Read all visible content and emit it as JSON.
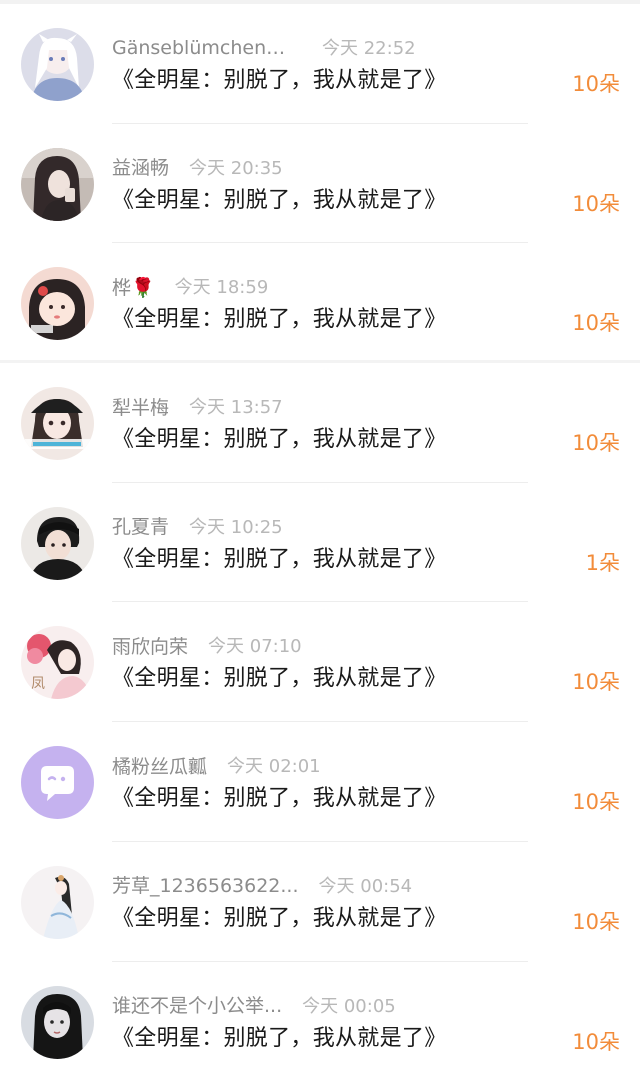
{
  "records": [
    {
      "name": "Gänseblümchen🌿...",
      "time": "今天 22:52",
      "message": "《全明星：别脱了，我从就是了》",
      "gift": "10朵",
      "avatar_icon": "anime-girl-avatar",
      "avatar_colors": [
        "#d9dbe8",
        "#ffffff"
      ]
    },
    {
      "name": "益涵畅",
      "time": "今天 20:35",
      "message": "《全明星：别脱了，我从就是了》",
      "gift": "10朵",
      "avatar_icon": "girl-photo-avatar",
      "avatar_colors": [
        "#bcb3ad",
        "#3a2f2b"
      ]
    },
    {
      "name": "桦🌹",
      "time": "今天 18:59",
      "message": "《全明星：别脱了，我从就是了》",
      "gift": "10朵",
      "avatar_icon": "doll-avatar",
      "avatar_colors": [
        "#f2d7cf",
        "#2b2323"
      ]
    },
    {
      "name": "犁半梅",
      "time": "今天 13:57",
      "message": "《全明星：别脱了，我从就是了》",
      "gift": "10朵",
      "avatar_icon": "girl-cap-avatar",
      "avatar_colors": [
        "#f3e6e1",
        "#222222"
      ]
    },
    {
      "name": "孔夏青",
      "time": "今天 10:25",
      "message": "《全明星：别脱了，我从就是了》",
      "gift": "1朵",
      "avatar_icon": "boy-photo-avatar",
      "avatar_colors": [
        "#e9e6e2",
        "#1e1e1e"
      ]
    },
    {
      "name": "雨欣向荣",
      "time": "今天 07:10",
      "message": "《全明星：别脱了，我从就是了》",
      "gift": "10朵",
      "avatar_icon": "flower-girl-avatar",
      "avatar_colors": [
        "#f6e9ea",
        "#d4576b"
      ]
    },
    {
      "name": "橘粉丝瓜瓤",
      "time": "今天 02:01",
      "message": "《全明星：别脱了，我从就是了》",
      "gift": "10朵",
      "avatar_icon": "default-chat-avatar",
      "avatar_colors": [
        "#c7b4f0",
        "#ffffff"
      ]
    },
    {
      "name": "芳草_1236563622...",
      "time": "今天 00:54",
      "message": "《全明星：别脱了，我从就是了》",
      "gift": "10朵",
      "avatar_icon": "hanfu-girl-avatar",
      "avatar_colors": [
        "#f4f1f2",
        "#2c2c2c"
      ]
    },
    {
      "name": "谁还不是个小公举...",
      "time": "今天 00:05",
      "message": "《全明星：别脱了，我从就是了》",
      "gift": "10朵",
      "avatar_icon": "dark-hair-girl-avatar",
      "avatar_colors": [
        "#d7dbe0",
        "#141414"
      ]
    }
  ]
}
